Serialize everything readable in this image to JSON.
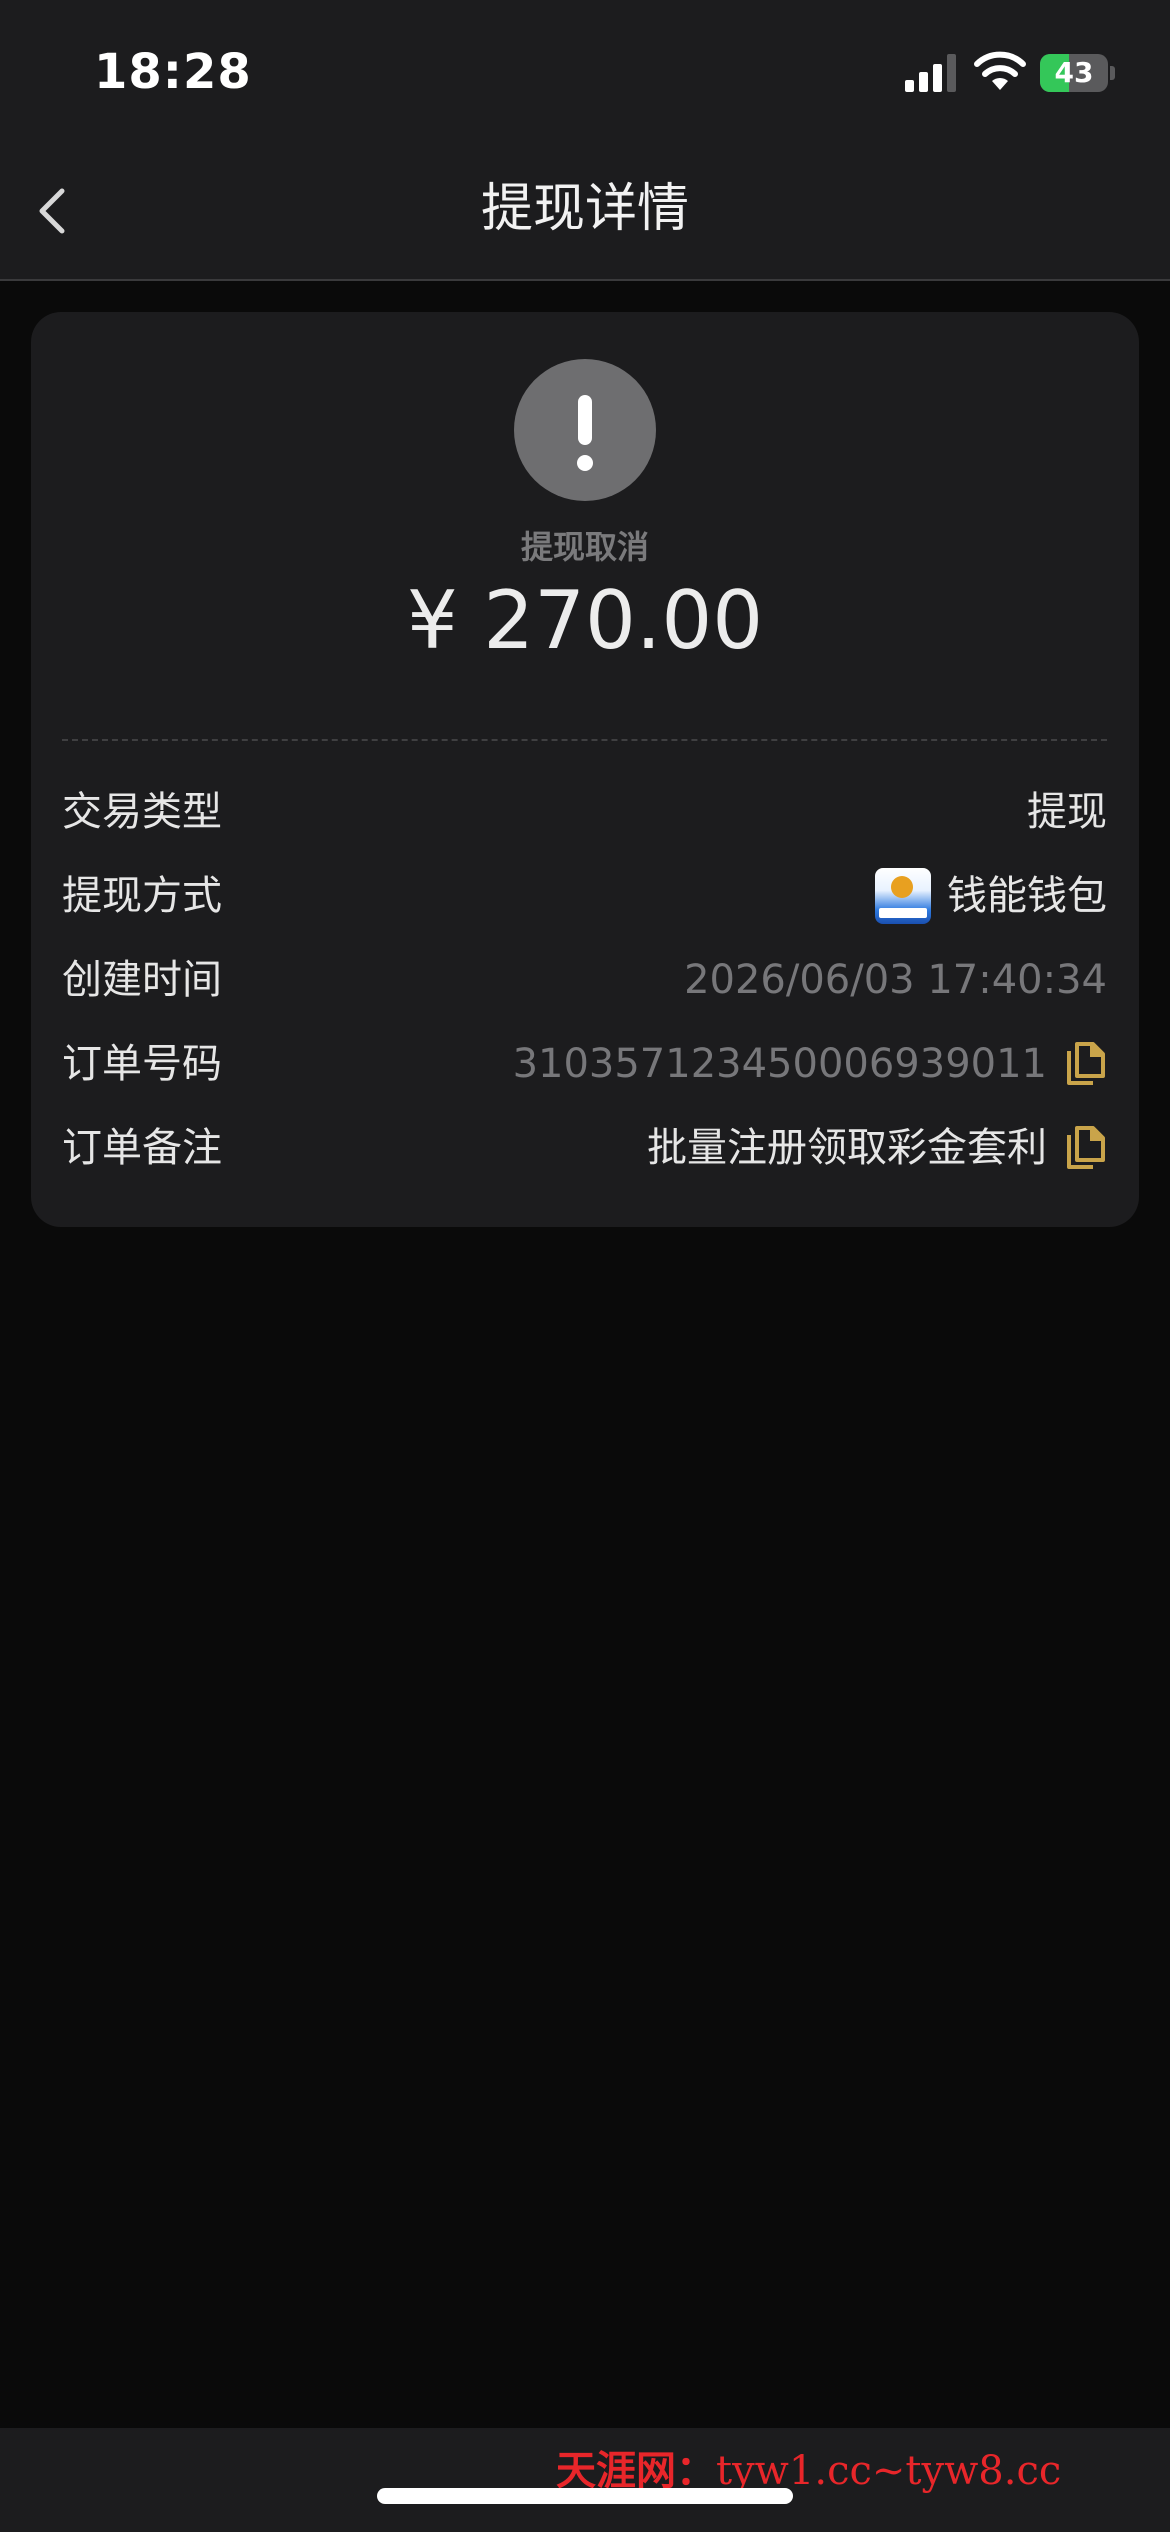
{
  "status_bar": {
    "time": "18:28",
    "battery_level": "43",
    "battery_fraction": 0.43
  },
  "nav": {
    "title": "提现详情"
  },
  "summary": {
    "status_label": "提现取消",
    "amount": "¥ 270.00"
  },
  "details": [
    {
      "label": "交易类型",
      "value": "提现"
    },
    {
      "label": "提现方式",
      "value": "钱能钱包"
    },
    {
      "label": "创建时间",
      "value": "2026/06/03 17:40:34"
    },
    {
      "label": "订单号码",
      "value": "310357123450006939011"
    },
    {
      "label": "订单备注",
      "value": "批量注册领取彩金套利"
    }
  ],
  "watermark": {
    "site_name": "天涯网：",
    "urls": "tyw1.cc~tyw8.cc"
  },
  "colors": {
    "accent_copy": "#c9a44a",
    "battery_green": "#34c759",
    "watermark_red": "#e8262a"
  },
  "icons": {
    "back": "chevron-left-icon",
    "status": "exclamation-icon",
    "copy": "copy-icon",
    "wallet": "wallet-app-logo"
  }
}
